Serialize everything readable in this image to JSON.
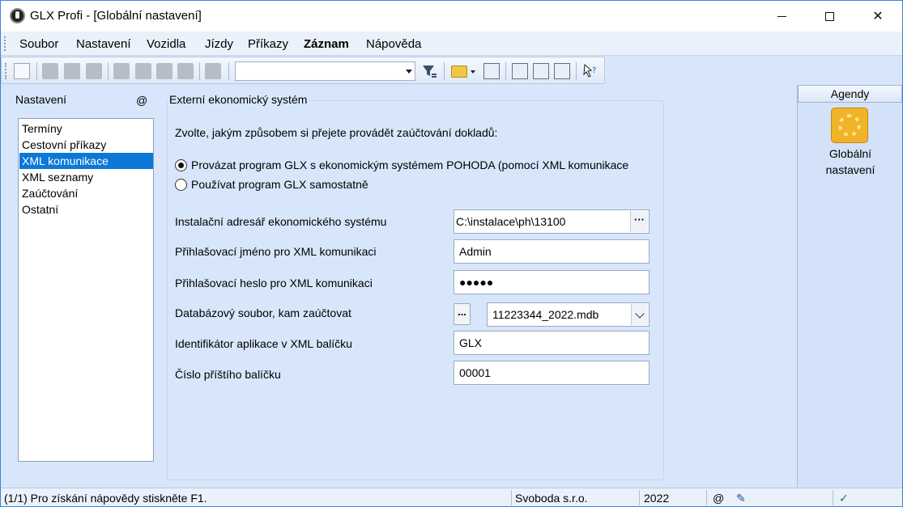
{
  "window": {
    "title": "GLX Profi - [Globální nastavení]",
    "minimize_glyph": "",
    "close_glyph": "✕"
  },
  "menu": [
    "Soubor",
    "Nastavení",
    "Vozidla",
    "Jízdy",
    "Příkazy",
    "Záznam",
    "Nápověda"
  ],
  "toolbar": {
    "combo_value": ""
  },
  "left_panel": {
    "title": "Nastavení",
    "at_symbol": "@",
    "items": [
      "Termíny",
      "Cestovní příkazy",
      "XML komunikace",
      "XML seznamy",
      "Zaúčtování",
      "Ostatní"
    ],
    "selected_index": 2
  },
  "main": {
    "group_title": "Externí ekonomický systém",
    "prompt": "Zvolte, jakým způsobem si přejete provádět zaúčtování dokladů:",
    "radio_link": "Provázat program GLX s ekonomickým systémem POHODA (pomocí XML komunikace",
    "radio_standalone": "Používat program GLX samostatně",
    "radio_selected": "link",
    "fields": {
      "install_dir_label": "Instalační adresář ekonomického systému",
      "install_dir_value": "C:\\instalace\\ph\\13100",
      "browse_glyph": "···",
      "login_label": "Přihlašovací jméno pro XML komunikaci",
      "login_value": "Admin",
      "password_label": "Přihlašovací heslo pro XML komunikaci",
      "password_value": "●●●●●",
      "db_label": "Databázový soubor, kam zaúčtovat",
      "db_button": "...",
      "db_value": "11223344_2022.mdb",
      "app_id_label": "Identifikátor aplikace v XML balíčku",
      "app_id_value": "GLX",
      "next_packet_label": "Číslo příštího balíčku",
      "next_packet_value": "00001"
    }
  },
  "right_panel": {
    "title": "Agendy",
    "agenda_label_1": "Globální",
    "agenda_label_2": "nastavení"
  },
  "status": {
    "help": "(1/1) Pro získání nápovědy stiskněte F1.",
    "company": "Svoboda s.r.o.",
    "year": "2022",
    "at": "@",
    "pencil": "✎",
    "check": "✓"
  },
  "colors": {
    "selection": "#0b78d7",
    "background": "#d7e6fb"
  }
}
